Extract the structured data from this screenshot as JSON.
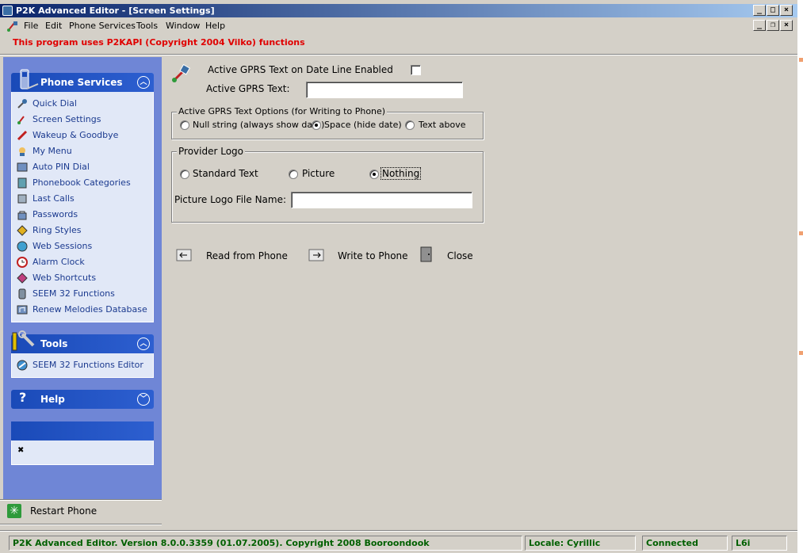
{
  "window": {
    "title": "P2K Advanced Editor - [Screen Settings]",
    "caption_buttons": [
      "_",
      "□",
      "×"
    ],
    "mdi_buttons": [
      "_",
      "❐",
      "×"
    ]
  },
  "menubar": {
    "items": [
      "File",
      "Edit",
      "Phone Services",
      "Tools",
      "Window",
      "Help"
    ]
  },
  "notice": "This program uses P2KAPI (Copyright 2004 Vilko) functions",
  "sidebar": {
    "phone_services": {
      "title": "Phone Services",
      "items": [
        {
          "label": "Quick Dial",
          "icon": "quick-dial-icon"
        },
        {
          "label": "Screen Settings",
          "icon": "screen-settings-icon"
        },
        {
          "label": "Wakeup & Goodbye",
          "icon": "wakeup-icon"
        },
        {
          "label": "My Menu",
          "icon": "my-menu-icon"
        },
        {
          "label": "Auto PIN Dial",
          "icon": "pin-dial-icon"
        },
        {
          "label": "Phonebook Categories",
          "icon": "phonebook-icon"
        },
        {
          "label": "Last Calls",
          "icon": "last-calls-icon"
        },
        {
          "label": "Passwords",
          "icon": "passwords-icon"
        },
        {
          "label": "Ring Styles",
          "icon": "ring-styles-icon"
        },
        {
          "label": "Web Sessions",
          "icon": "web-sessions-icon"
        },
        {
          "label": "Alarm Clock",
          "icon": "alarm-clock-icon"
        },
        {
          "label": "Web Shortcuts",
          "icon": "web-shortcuts-icon"
        },
        {
          "label": "SEEM 32 Functions",
          "icon": "seem-functions-icon"
        },
        {
          "label": "Renew Melodies Database",
          "icon": "melodies-icon"
        }
      ]
    },
    "tools": {
      "title": "Tools",
      "items": [
        {
          "label": "SEEM 32 Functions Editor",
          "icon": "seem-editor-icon"
        }
      ]
    },
    "help": {
      "title": "Help"
    },
    "info_close": "✖",
    "restart_label": "Restart Phone"
  },
  "form": {
    "gprs_enabled_label": "Active GPRS Text on Date Line Enabled",
    "gprs_enabled_checked": false,
    "gprs_text_label": "Active GPRS Text:",
    "gprs_text_value": "",
    "options_group_title": "Active GPRS Text Options (for Writing to Phone)",
    "options": [
      {
        "label": "Null string (always show date)",
        "selected": false
      },
      {
        "label": "Space (hide date)",
        "selected": true
      },
      {
        "label": "Text above",
        "selected": false
      }
    ],
    "logo_group_title": "Provider Logo",
    "logo_options": [
      {
        "label": "Standard Text",
        "selected": false
      },
      {
        "label": "Picture",
        "selected": false
      },
      {
        "label": "Nothing",
        "selected": true
      }
    ],
    "logo_file_label": "Picture Logo File Name:",
    "logo_file_value": "",
    "actions": {
      "read": "Read from Phone",
      "write": "Write to Phone",
      "close": "Close"
    }
  },
  "statusbar": {
    "version": "P2K Advanced Editor. Version 8.0.0.3359 (01.07.2005). Copyright 2008 Booroondook",
    "locale": "Locale: Cyrillic",
    "connection": "Connected",
    "model": "L6i"
  },
  "colors": {
    "face": "#d4d0c8",
    "title_start": "#0a246a",
    "title_end": "#a6caf0",
    "sidebar": "#6f86d6",
    "panel_head": "#1a4ab8",
    "panel_body": "#e1e8f7",
    "link_text": "#1b3a8f",
    "notice": "#e00000",
    "status_text": "#006000"
  }
}
